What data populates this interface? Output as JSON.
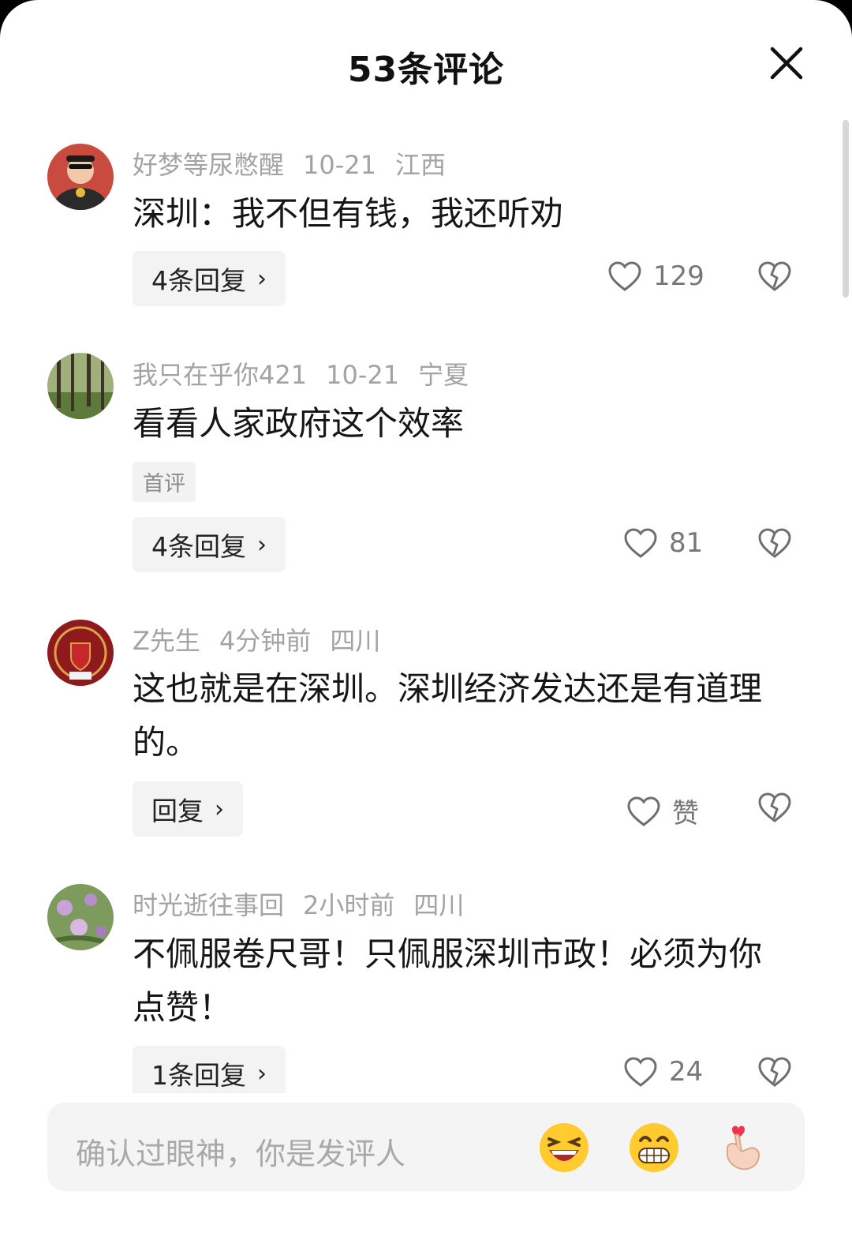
{
  "header": {
    "title": "53条评论"
  },
  "comments": [
    {
      "username": "好梦等尿憋醒",
      "date": "10-21",
      "location": "江西",
      "text": "深圳：我不但有钱，我还听劝",
      "tag": "",
      "reply_label": "4条回复",
      "likes": "129"
    },
    {
      "username": "我只在乎你421",
      "date": "10-21",
      "location": "宁夏",
      "text": "看看人家政府这个效率",
      "tag": "首评",
      "reply_label": "4条回复",
      "likes": "81"
    },
    {
      "username": "Z先生",
      "date": "4分钟前",
      "location": "四川",
      "text": "这也就是在深圳。深圳经济发达还是有道理的。",
      "tag": "",
      "reply_label": "回复",
      "likes": "赞"
    },
    {
      "username": "时光逝往事回",
      "date": "2小时前",
      "location": "四川",
      "text": "不佩服卷尺哥！只佩服深圳市政！必须为你点赞！",
      "tag": "",
      "reply_label": "1条回复",
      "likes": "24"
    }
  ],
  "input": {
    "placeholder": "确认过眼神，你是发评人"
  },
  "icons": {
    "close": "close-icon",
    "like": "heart-outline-icon",
    "dislike": "broken-heart-icon",
    "emoji_1": "laughing-emoji-icon",
    "emoji_2": "grinning-emoji-icon",
    "emoji_3": "finger-heart-emoji-icon"
  },
  "colors": {
    "text_primary": "#161616",
    "text_secondary": "#a3a3a3",
    "reply_bg": "#f3f3f3",
    "input_bg": "#f4f4f4"
  }
}
